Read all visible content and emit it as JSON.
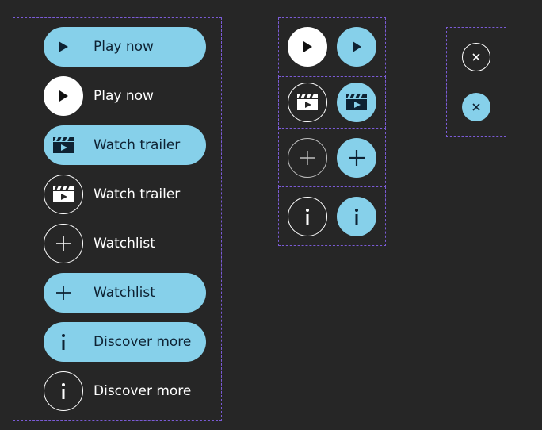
{
  "labels": {
    "play_now": "Play now",
    "watch_trailer": "Watch trailer",
    "watchlist": "Watchlist",
    "discover_more": "Discover more"
  },
  "icons": {
    "play": "play-icon",
    "trailer": "clapperboard-play-icon",
    "add": "plus-icon",
    "info": "info-icon",
    "close": "close-icon"
  },
  "colors": {
    "background": "#262626",
    "accent": "#86d0ea",
    "on_accent": "#0e2233",
    "white": "#ffffff",
    "frame": "#7b5bd6"
  }
}
